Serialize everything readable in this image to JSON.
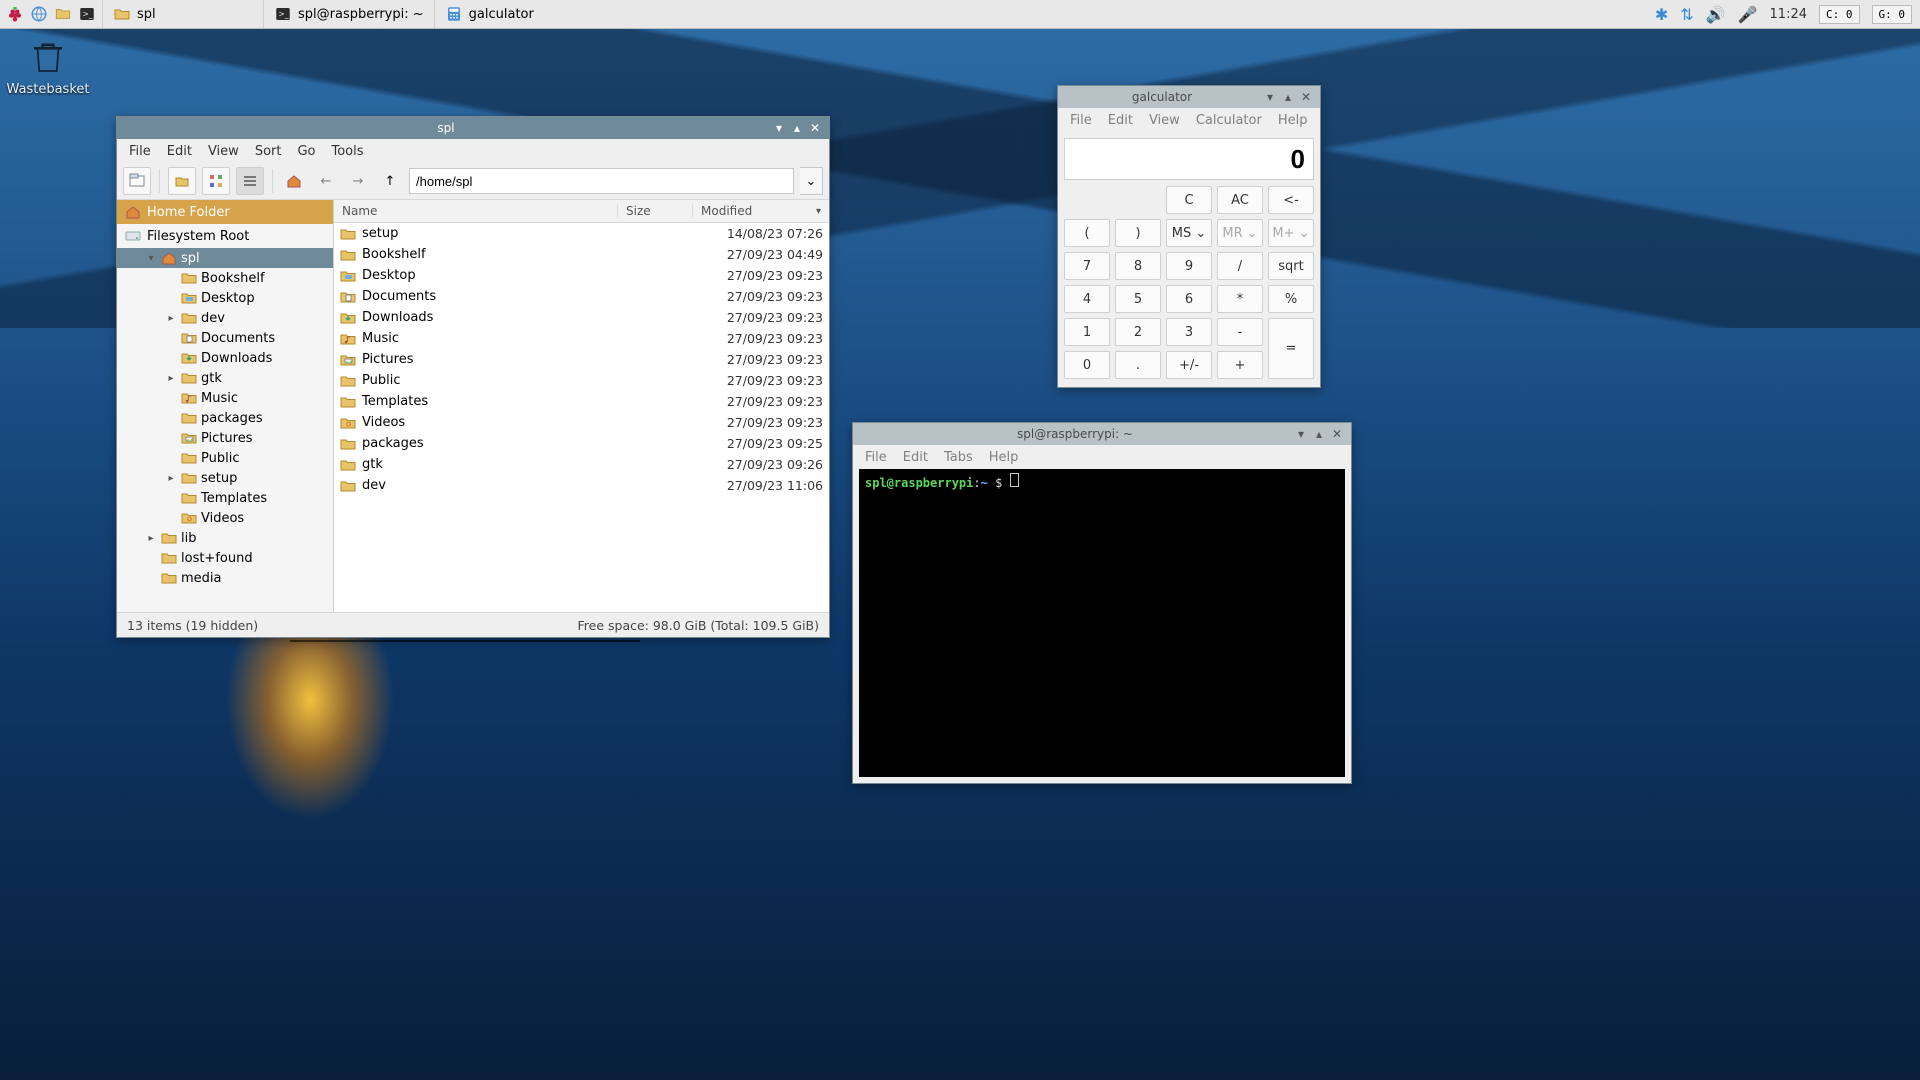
{
  "panel": {
    "tasks": [
      {
        "icon": "folder",
        "label": "spl"
      },
      {
        "icon": "terminal",
        "label": "spl@raspberrypi: ~"
      },
      {
        "icon": "calc",
        "label": "galculator"
      }
    ],
    "clock": "11:24",
    "indicators": [
      "C: 0",
      "G: 0"
    ]
  },
  "desktop": {
    "wastebasket": "Wastebasket"
  },
  "filemanager": {
    "title": "spl",
    "menus": [
      "File",
      "Edit",
      "View",
      "Sort",
      "Go",
      "Tools"
    ],
    "path": "/home/spl",
    "places": [
      {
        "label": "Home Folder",
        "icon": "home",
        "selected": true
      },
      {
        "label": "Filesystem Root",
        "icon": "disk"
      }
    ],
    "tree": [
      {
        "depth": 1,
        "exp": "▾",
        "icon": "home",
        "label": "spl",
        "sel": true
      },
      {
        "depth": 2,
        "exp": "",
        "icon": "folder",
        "label": "Bookshelf"
      },
      {
        "depth": 2,
        "exp": "",
        "icon": "desktop",
        "label": "Desktop"
      },
      {
        "depth": 2,
        "exp": "▸",
        "icon": "folder",
        "label": "dev"
      },
      {
        "depth": 2,
        "exp": "",
        "icon": "docs",
        "label": "Documents"
      },
      {
        "depth": 2,
        "exp": "",
        "icon": "dl",
        "label": "Downloads"
      },
      {
        "depth": 2,
        "exp": "▸",
        "icon": "folder",
        "label": "gtk"
      },
      {
        "depth": 2,
        "exp": "",
        "icon": "music",
        "label": "Music"
      },
      {
        "depth": 2,
        "exp": "",
        "icon": "folder",
        "label": "packages"
      },
      {
        "depth": 2,
        "exp": "",
        "icon": "pics",
        "label": "Pictures"
      },
      {
        "depth": 2,
        "exp": "",
        "icon": "folder",
        "label": "Public"
      },
      {
        "depth": 2,
        "exp": "▸",
        "icon": "folder",
        "label": "setup"
      },
      {
        "depth": 2,
        "exp": "",
        "icon": "folder",
        "label": "Templates"
      },
      {
        "depth": 2,
        "exp": "",
        "icon": "video",
        "label": "Videos"
      },
      {
        "depth": 1,
        "exp": "▸",
        "icon": "folder",
        "label": "lib"
      },
      {
        "depth": 1,
        "exp": "",
        "icon": "folder",
        "label": "lost+found"
      },
      {
        "depth": 1,
        "exp": "",
        "icon": "folder",
        "label": "media"
      }
    ],
    "columns": {
      "name": "Name",
      "size": "Size",
      "modified": "Modified"
    },
    "rows": [
      {
        "icon": "folder",
        "name": "setup",
        "mod": "14/08/23 07:26"
      },
      {
        "icon": "folder",
        "name": "Bookshelf",
        "mod": "27/09/23 04:49"
      },
      {
        "icon": "desktop",
        "name": "Desktop",
        "mod": "27/09/23 09:23"
      },
      {
        "icon": "docs",
        "name": "Documents",
        "mod": "27/09/23 09:23"
      },
      {
        "icon": "dl",
        "name": "Downloads",
        "mod": "27/09/23 09:23"
      },
      {
        "icon": "music",
        "name": "Music",
        "mod": "27/09/23 09:23"
      },
      {
        "icon": "pics",
        "name": "Pictures",
        "mod": "27/09/23 09:23"
      },
      {
        "icon": "folder",
        "name": "Public",
        "mod": "27/09/23 09:23"
      },
      {
        "icon": "folder",
        "name": "Templates",
        "mod": "27/09/23 09:23"
      },
      {
        "icon": "video",
        "name": "Videos",
        "mod": "27/09/23 09:23"
      },
      {
        "icon": "folder",
        "name": "packages",
        "mod": "27/09/23 09:25"
      },
      {
        "icon": "folder",
        "name": "gtk",
        "mod": "27/09/23 09:26"
      },
      {
        "icon": "folder",
        "name": "dev",
        "mod": "27/09/23 11:06"
      }
    ],
    "status_left": "13 items (19 hidden)",
    "status_right": "Free space: 98.0 GiB (Total: 109.5 GiB)"
  },
  "calculator": {
    "title": "galculator",
    "menus": [
      "File",
      "Edit",
      "View",
      "Calculator",
      "Help"
    ],
    "display": "0",
    "rows": [
      [
        "ghost",
        "ghost",
        "C",
        "AC",
        "<-"
      ],
      [
        "(",
        ")",
        "MS ⌄",
        "MR ⌄",
        "M+ ⌄"
      ],
      [
        "7",
        "8",
        "9",
        "/",
        "sqrt"
      ],
      [
        "4",
        "5",
        "6",
        "*",
        "%"
      ],
      [
        "1",
        "2",
        "3",
        "-",
        "=tall"
      ],
      [
        "0",
        ".",
        "+/-",
        "+"
      ]
    ],
    "dim_keys": [
      "MR ⌄",
      "M+ ⌄"
    ]
  },
  "terminal": {
    "title": "spl@raspberrypi: ~",
    "menus": [
      "File",
      "Edit",
      "Tabs",
      "Help"
    ],
    "ps_user": "spl@raspberrypi",
    "ps_sep": ":",
    "ps_path": "~",
    "ps_dollar": " $ "
  }
}
